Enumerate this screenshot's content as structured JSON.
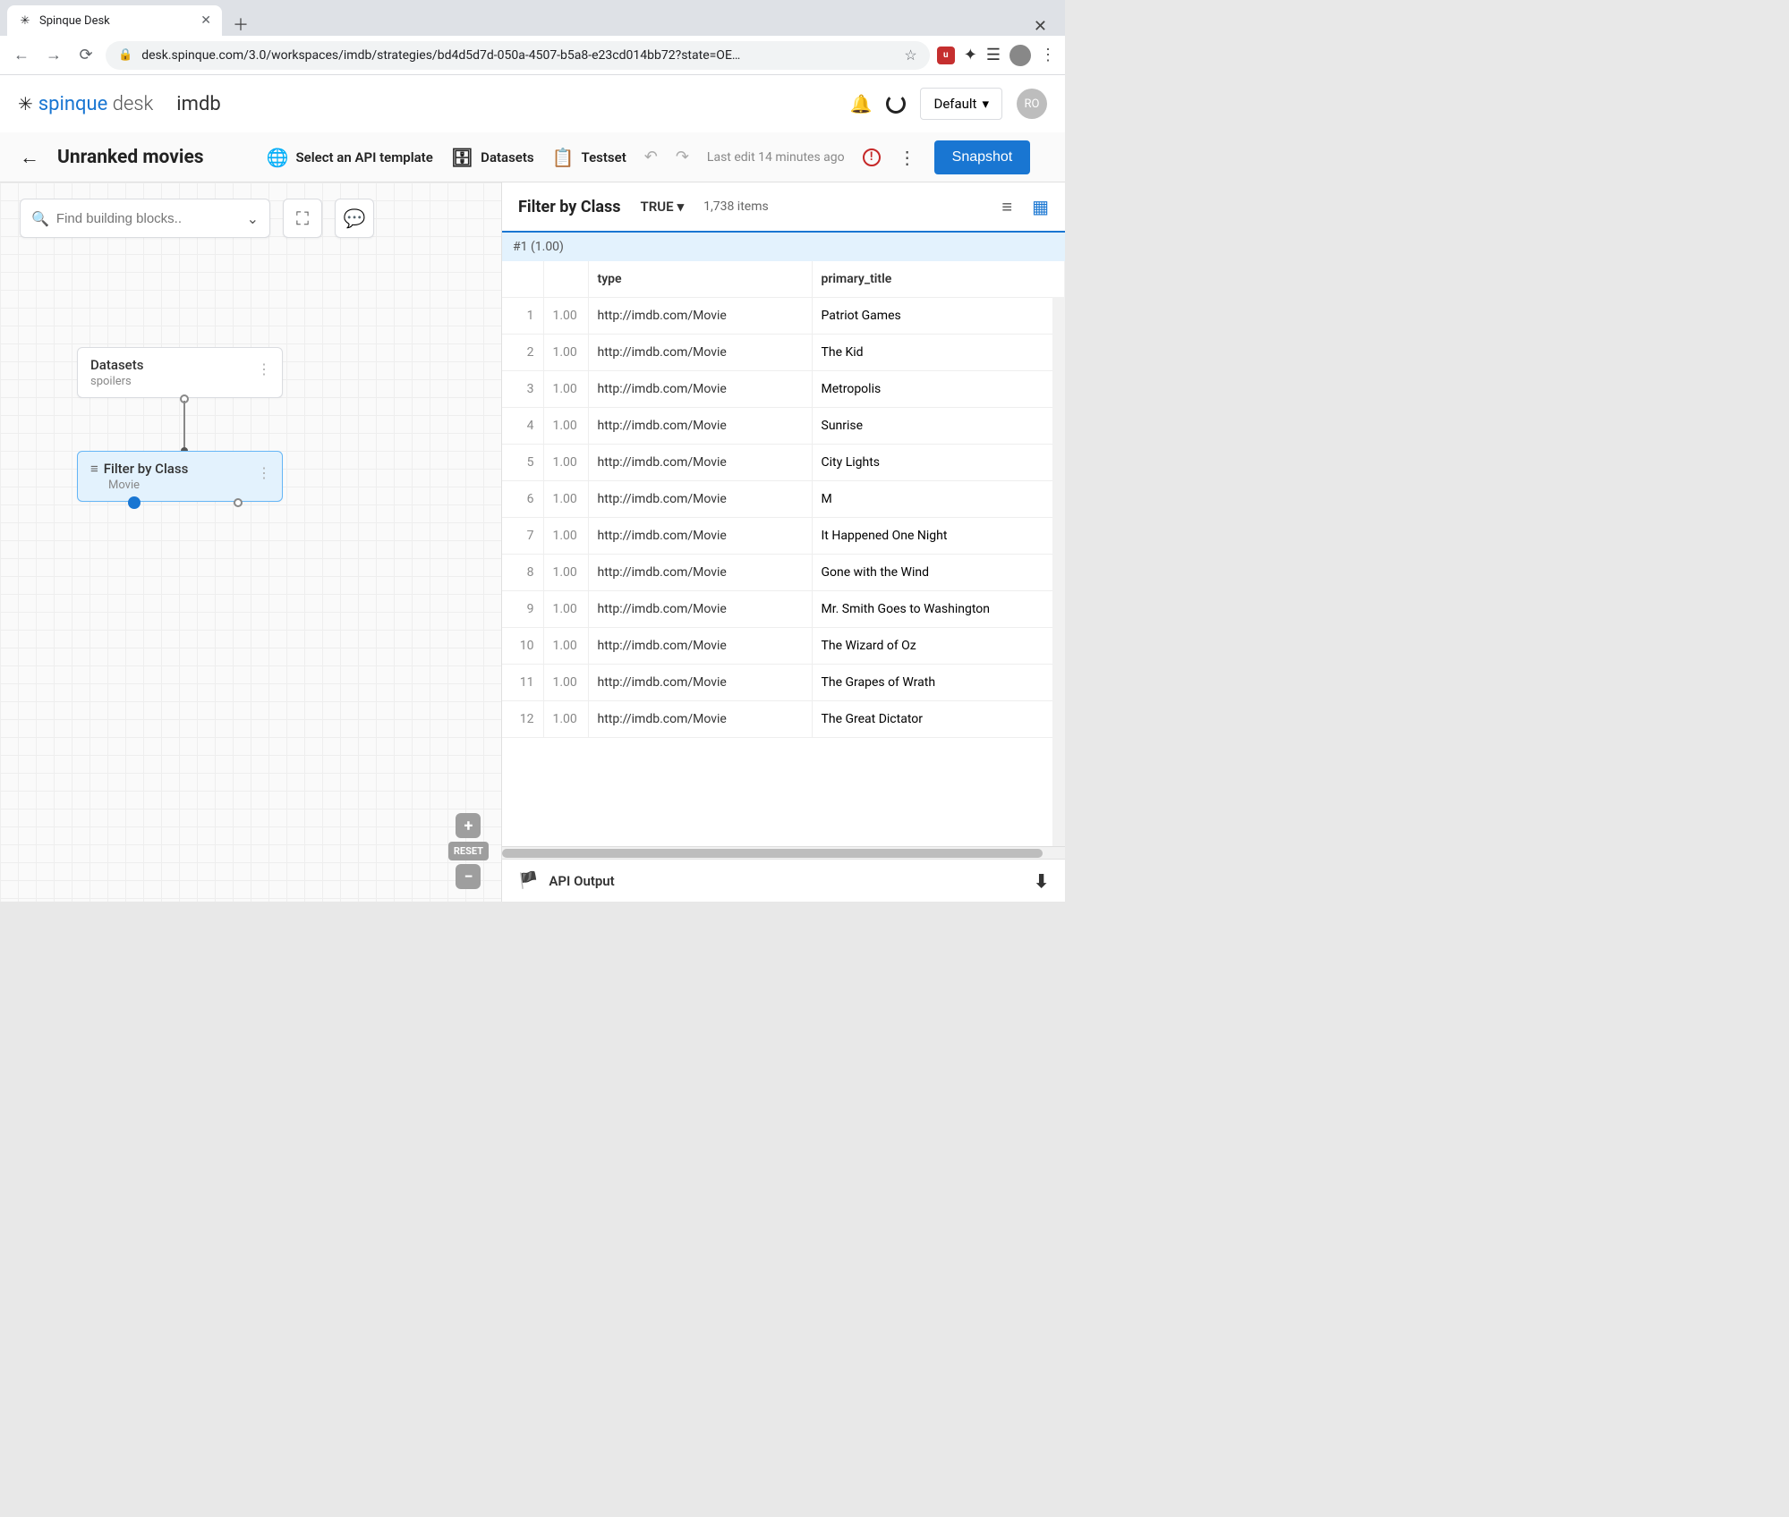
{
  "browser": {
    "tab_title": "Spinque Desk",
    "url": "desk.spinque.com/3.0/workspaces/imdb/strategies/bd4d5d7d-050a-4507-b5a8-e23cd014bb72?state=OE…"
  },
  "app": {
    "logo_prefix": "spinque",
    "logo_suffix": "desk",
    "workspace": "imdb",
    "env_label": "Default",
    "user_initials": "RO"
  },
  "strategy": {
    "title": "Unranked movies",
    "api_template": "Select an API template",
    "datasets": "Datasets",
    "testset": "Testset",
    "last_edit": "Last edit 14 minutes ago",
    "snapshot": "Snapshot"
  },
  "canvas": {
    "search_placeholder": "Find building blocks..",
    "reset": "RESET",
    "nodes": {
      "datasets": {
        "title": "Datasets",
        "sub": "spoilers"
      },
      "filter": {
        "title": "Filter by Class",
        "sub": "Movie"
      }
    }
  },
  "results": {
    "title": "Filter by Class",
    "mode": "TRUE",
    "count": "1,738 items",
    "band": "#1 (1.00)",
    "columns": {
      "type": "type",
      "primary_title": "primary_title"
    },
    "rows": [
      {
        "idx": "1",
        "score": "1.00",
        "type": "http://imdb.com/Movie",
        "title": "Patriot Games"
      },
      {
        "idx": "2",
        "score": "1.00",
        "type": "http://imdb.com/Movie",
        "title": "The Kid"
      },
      {
        "idx": "3",
        "score": "1.00",
        "type": "http://imdb.com/Movie",
        "title": "Metropolis"
      },
      {
        "idx": "4",
        "score": "1.00",
        "type": "http://imdb.com/Movie",
        "title": "Sunrise"
      },
      {
        "idx": "5",
        "score": "1.00",
        "type": "http://imdb.com/Movie",
        "title": "City Lights"
      },
      {
        "idx": "6",
        "score": "1.00",
        "type": "http://imdb.com/Movie",
        "title": "M"
      },
      {
        "idx": "7",
        "score": "1.00",
        "type": "http://imdb.com/Movie",
        "title": "It Happened One Night"
      },
      {
        "idx": "8",
        "score": "1.00",
        "type": "http://imdb.com/Movie",
        "title": "Gone with the Wind"
      },
      {
        "idx": "9",
        "score": "1.00",
        "type": "http://imdb.com/Movie",
        "title": "Mr. Smith Goes to Washington"
      },
      {
        "idx": "10",
        "score": "1.00",
        "type": "http://imdb.com/Movie",
        "title": "The Wizard of Oz"
      },
      {
        "idx": "11",
        "score": "1.00",
        "type": "http://imdb.com/Movie",
        "title": "The Grapes of Wrath"
      },
      {
        "idx": "12",
        "score": "1.00",
        "type": "http://imdb.com/Movie",
        "title": "The Great Dictator"
      }
    ],
    "api_output": "API Output"
  }
}
